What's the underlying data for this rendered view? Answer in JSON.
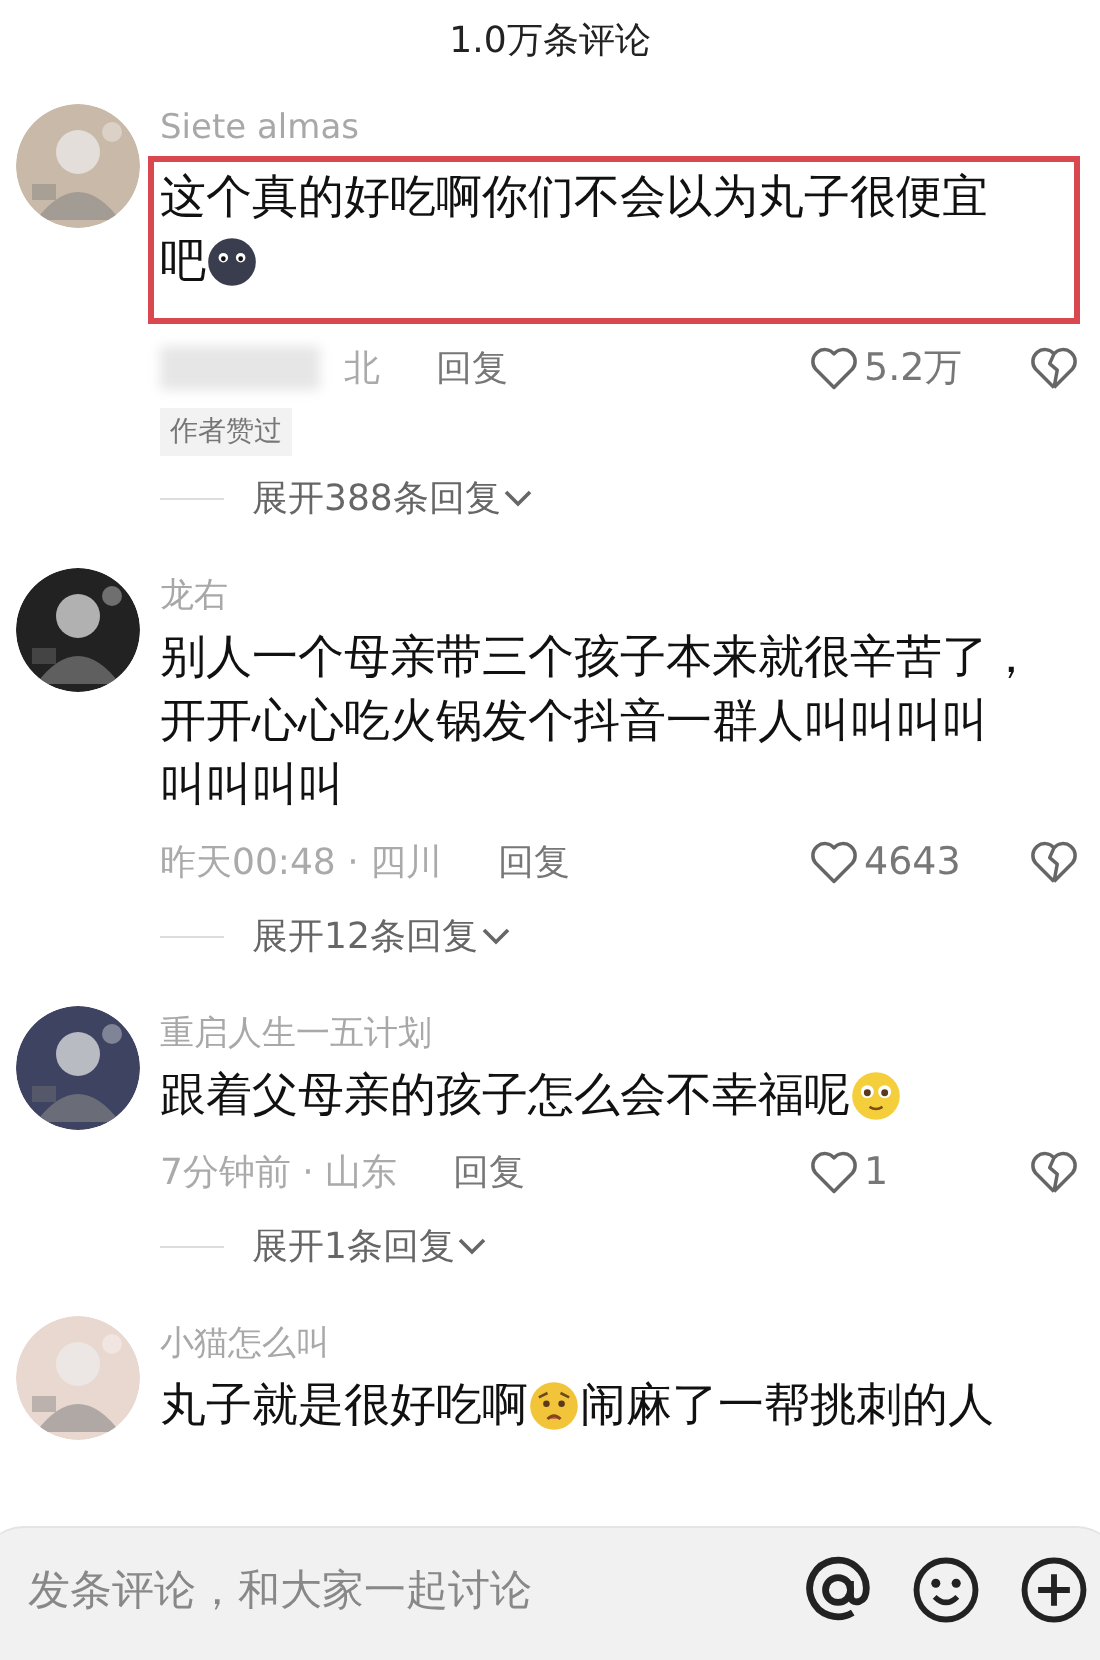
{
  "header": {
    "title": "1.0万条评论"
  },
  "comments": [
    {
      "user": "Siete almas",
      "highlighted": true,
      "lines": [
        [
          {
            "kind": "text",
            "text": "这个真的好吃啊你们不会以为丸子很便宜"
          }
        ],
        [
          {
            "kind": "text",
            "text": "吧"
          },
          {
            "kind": "dark-emoji"
          }
        ]
      ],
      "meta_blurred": true,
      "meta": "北",
      "reply": "回复",
      "likes": "5.2万",
      "badge": "作者赞过",
      "expand": "展开388条回复"
    },
    {
      "user": "龙右",
      "lines": [
        [
          {
            "kind": "text",
            "text": "别人一个母亲带三个孩子本来就很辛苦了，"
          }
        ],
        [
          {
            "kind": "text",
            "text": "开开心心吃火锅发个抖音一群人叫叫叫叫"
          }
        ],
        [
          {
            "kind": "text",
            "text": "叫叫叫叫"
          }
        ]
      ],
      "meta": "昨天00:48 · 四川",
      "reply": "回复",
      "likes": "4643",
      "expand": "展开12条回复"
    },
    {
      "user": "重启人生一五计划",
      "lines": [
        [
          {
            "kind": "text",
            "text": "跟着父母亲的孩子怎么会不幸福呢"
          },
          {
            "kind": "pleading-emoji"
          }
        ]
      ],
      "meta": "7分钟前 · 山东",
      "reply": "回复",
      "likes": "1",
      "expand": "展开1条回复"
    },
    {
      "user": "小猫怎么叫",
      "lines": [
        [
          {
            "kind": "text",
            "text": "丸子就是很好吃啊"
          },
          {
            "kind": "worried-emoji"
          },
          {
            "kind": "text",
            "text": "闹麻了一帮挑刺的人"
          }
        ]
      ]
    }
  ],
  "input": {
    "placeholder": "发条评论，和大家一起讨论"
  }
}
